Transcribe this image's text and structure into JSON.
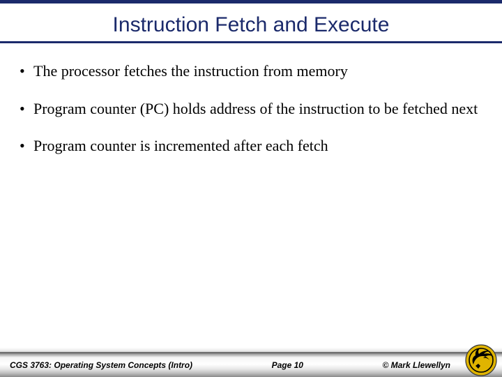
{
  "title": "Instruction Fetch and Execute",
  "bullets": [
    "The processor fetches the instruction from memory",
    "Program counter (PC) holds address of the instruction to be fetched next",
    "Program counter is incremented after each fetch"
  ],
  "footer": {
    "course": "CGS 3763: Operating System Concepts (Intro)",
    "page": "Page 10",
    "copyright": "© Mark Llewellyn"
  },
  "colors": {
    "accent": "#1b2a6b",
    "logo_gold": "#e0b400"
  }
}
